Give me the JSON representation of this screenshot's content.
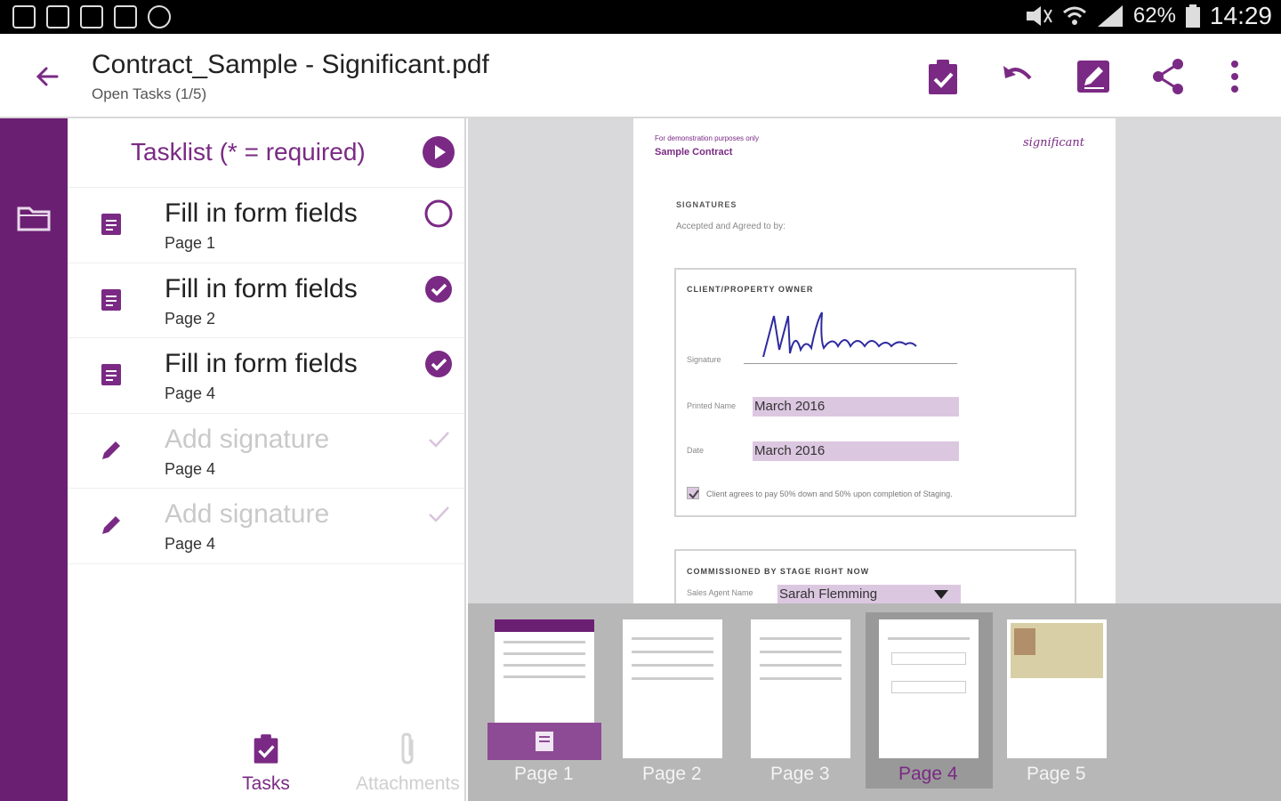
{
  "status_bar": {
    "battery": "62%",
    "time": "14:29"
  },
  "app_bar": {
    "title": "Contract_Sample - Significant.pdf",
    "subtitle": "Open Tasks (1/5)",
    "icons": [
      "back-arrow-icon",
      "task-check-icon",
      "undo-icon",
      "edit-sign-icon",
      "share-icon",
      "more-vert-icon"
    ]
  },
  "sidebar": {
    "icons": [
      "folder-icon"
    ]
  },
  "tasklist": {
    "title": "Tasklist (* = required)",
    "items": [
      {
        "label": "Fill in form fields",
        "page": "Page 1",
        "state": "open",
        "icon": "form-icon"
      },
      {
        "label": "Fill in form fields",
        "page": "Page 2",
        "state": "done",
        "icon": "form-icon"
      },
      {
        "label": "Fill in form fields",
        "page": "Page 4",
        "state": "done",
        "icon": "form-icon"
      },
      {
        "label": "Add signature",
        "page": "Page 4",
        "state": "check",
        "icon": "pen-icon"
      },
      {
        "label": "Add signature",
        "page": "Page 4",
        "state": "check",
        "icon": "pen-icon"
      }
    ]
  },
  "bottom_tabs": {
    "tasks": "Tasks",
    "attachments": "Attachments"
  },
  "document": {
    "header_small": "For demonstration purposes only",
    "header_title": "Sample Contract",
    "logo": "significant",
    "section": "Signatures",
    "accepted": "Accepted and Agreed to by:",
    "box1_title": "Client/Property Owner",
    "signature_label": "Signature",
    "printed_name_label": "Printed Name",
    "printed_name_value": "March 2016",
    "date_label": "Date",
    "date_value": "March 2016",
    "checkbox_text": "Client agrees to pay 50% down and 50% upon completion of Staging.",
    "box2_title": "Commissioned by Stage Right Now",
    "sales_agent_label": "Sales Agent Name",
    "sales_agent_value": "Sarah Flemming"
  },
  "thumbnails": [
    {
      "label": "Page 1"
    },
    {
      "label": "Page 2"
    },
    {
      "label": "Page 3"
    },
    {
      "label": "Page 4",
      "selected": true
    },
    {
      "label": "Page 5"
    }
  ],
  "colors": {
    "accent": "#7a2a84",
    "rail": "#6b1f73",
    "field": "#dcc7e0"
  }
}
